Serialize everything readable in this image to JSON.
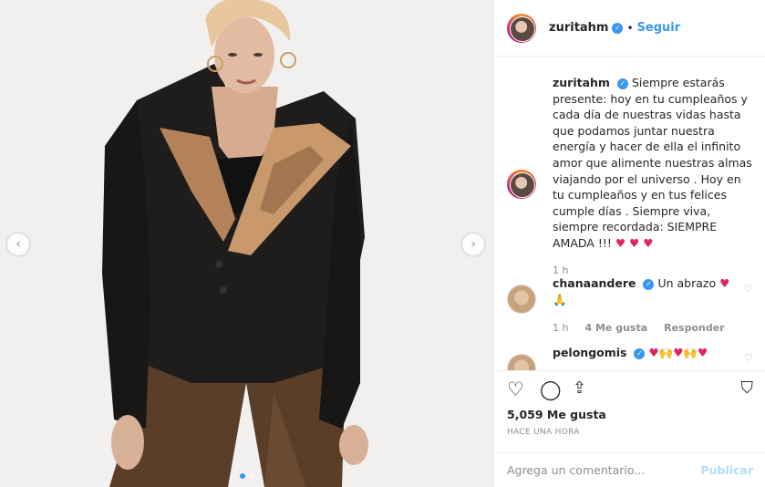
{
  "post": {
    "username": "zuritahm",
    "follow_label": "Seguir",
    "separator": "•",
    "caption": "Siempre estarás presente: hoy en tu cumpleaños y cada día de nuestras vidas hasta que podamos juntar nuestra energía y hacer de ella el infinito amor que alimente nuestras almas viajando por el universo . Hoy en tu cumpleaños y en tus felices cumple días . Siempre viva, siempre recordada: SIEMPRE AMADA !!!",
    "caption_emoji": "♥ ♥ ♥",
    "caption_time": "1 h"
  },
  "comments": [
    {
      "username": "chanaandere",
      "text": "Un abrazo",
      "emoji": "♥ 🙏",
      "time": "1 h",
      "likes": "4 Me gusta",
      "reply": "Responder"
    },
    {
      "username": "pelongomis",
      "text": "",
      "emoji": "♥🙌♥🙌♥"
    }
  ],
  "stats": {
    "likes": "5,059 Me gusta",
    "timestamp": "HACE UNA HORA"
  },
  "composer": {
    "placeholder": "Agrega un comentario...",
    "post_label": "Publicar"
  },
  "icons": {
    "prev": "chevron-left-icon",
    "next": "chevron-right-icon",
    "like": "heart-icon",
    "comment": "comment-icon",
    "share": "share-icon",
    "save": "bookmark-icon"
  },
  "carousel": {
    "total": 2,
    "current": 1
  },
  "colors": {
    "accent": "#3897f0",
    "heart": "#e0245e",
    "muted": "#8e8e8e"
  }
}
